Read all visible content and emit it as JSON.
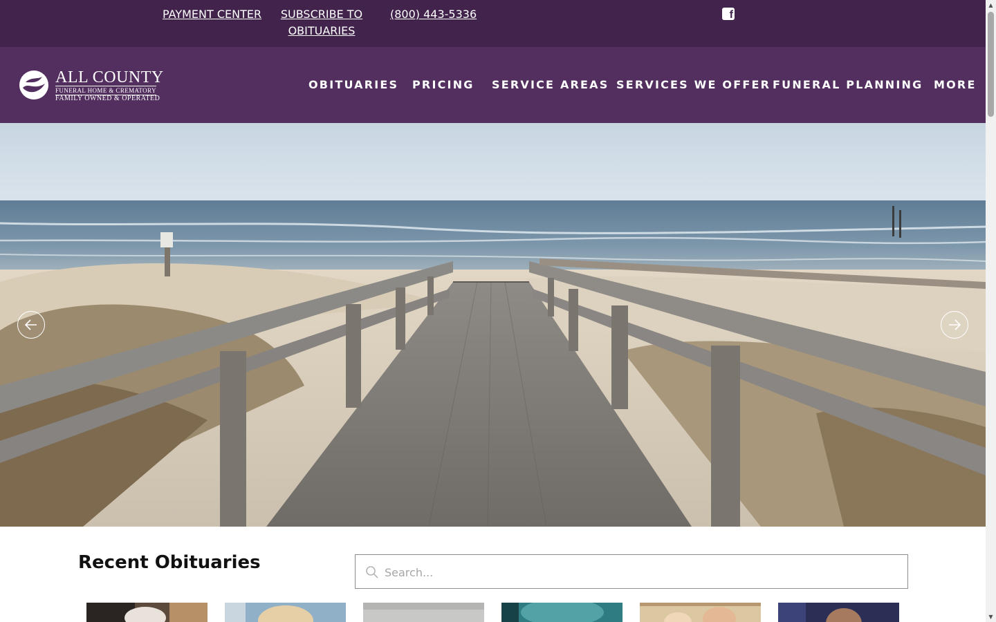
{
  "topbar": {
    "payment_label": "PAYMENT CENTER",
    "subscribe_label": "SUBSCRIBE TO OBITUARIES",
    "phone_label": "(800) 443-5336",
    "social_icon": "facebook-square-icon",
    "bg_color": "#41234c"
  },
  "header": {
    "bg_color": "#532f60",
    "logo": {
      "title": "ALL COUNTY",
      "subtitle": "FUNERAL HOME & CREMATORY",
      "tagline": "FAMILY OWNED & OPERATED"
    },
    "nav": [
      {
        "label": "OBITUARIES"
      },
      {
        "label": "PRICING"
      },
      {
        "label": "SERVICE AREAS"
      },
      {
        "label": "SERVICES WE OFFER"
      },
      {
        "label": "FUNERAL PLANNING"
      },
      {
        "label": "MORE"
      }
    ]
  },
  "hero": {
    "prev_icon": "arrow-left-icon",
    "next_icon": "arrow-right-icon"
  },
  "obituaries": {
    "title": "Recent Obituaries",
    "search_placeholder": "Search...",
    "search_icon": "search-icon",
    "cards": [
      {
        "index": 1
      },
      {
        "index": 2
      },
      {
        "index": 3
      },
      {
        "index": 4
      },
      {
        "index": 5
      },
      {
        "index": 6
      }
    ]
  }
}
